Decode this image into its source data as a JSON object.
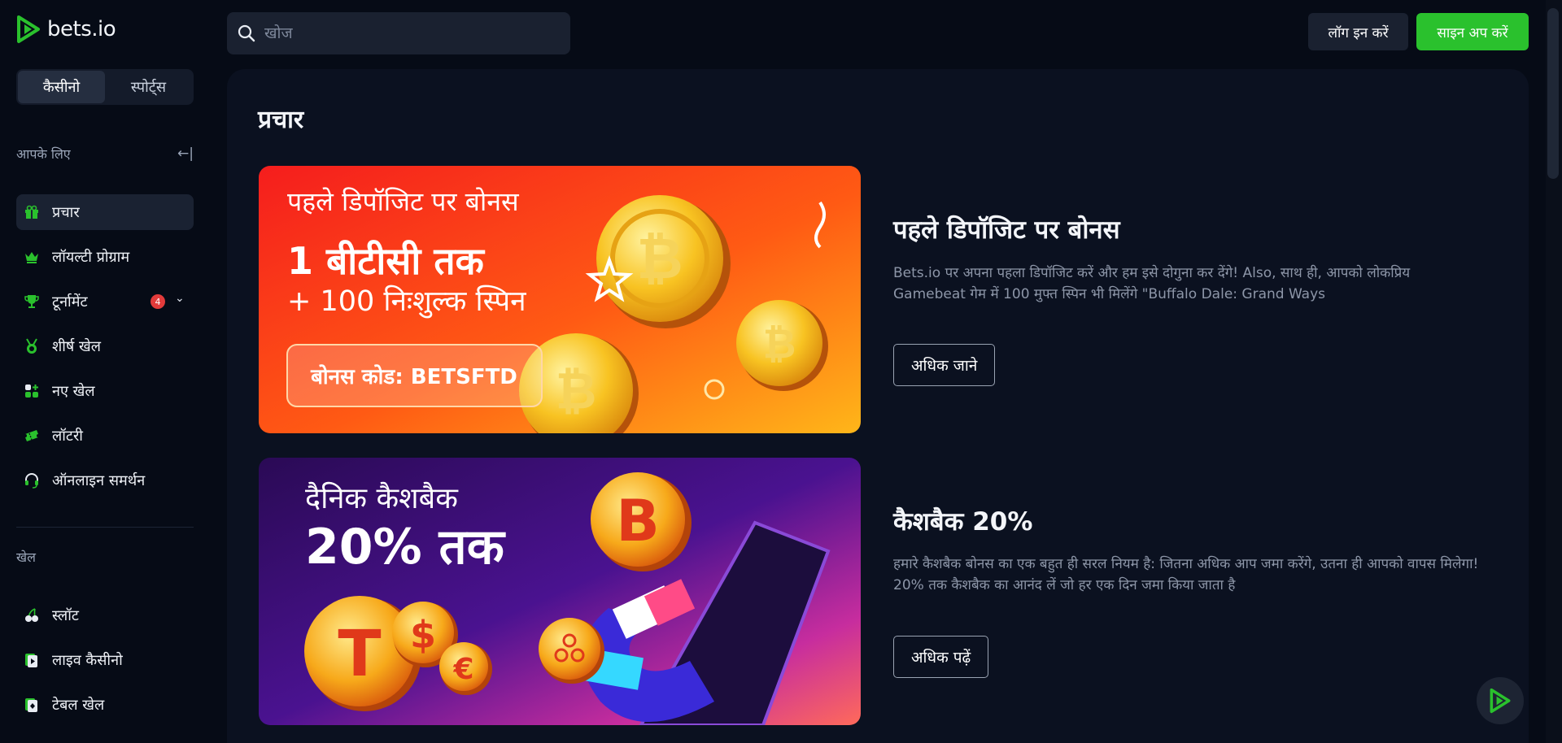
{
  "brand": {
    "name": "bets.io",
    "accent": "#2ac12d"
  },
  "mode_switch": {
    "casino": "कैसीनो",
    "sports": "स्पोर्ट्स"
  },
  "for_you": {
    "label": "आपके लिए",
    "collapse_icon": "collapse-left-icon"
  },
  "nav": [
    {
      "label": "प्रचार",
      "icon": "gift-icon",
      "active": true
    },
    {
      "label": "लॉयल्टी प्रोग्राम",
      "icon": "crown-icon"
    },
    {
      "label": "टूर्नामेंट",
      "icon": "trophy-icon",
      "badge": "4"
    },
    {
      "label": "शीर्ष खेल",
      "icon": "medal-icon"
    },
    {
      "label": "नए खेल",
      "icon": "new-games-icon"
    },
    {
      "label": "लॉटरी",
      "icon": "ticket-icon"
    },
    {
      "label": "ऑनलाइन समर्थन",
      "icon": "headset-icon"
    }
  ],
  "games_section": {
    "label": "खेल"
  },
  "games_nav": [
    {
      "label": "स्लॉट",
      "icon": "cherry-icon"
    },
    {
      "label": "लाइव कैसीनो",
      "icon": "live-casino-icon"
    },
    {
      "label": "टेबल खेल",
      "icon": "table-games-icon"
    }
  ],
  "search": {
    "placeholder": "खोज"
  },
  "header": {
    "login": "लॉग इन करें",
    "signup": "साइन अप करें"
  },
  "page": {
    "title": "प्रचार"
  },
  "promos": [
    {
      "banner": {
        "line1": "पहले डिपॉजिट पर बोनस",
        "line2": "1 बीटीसी तक",
        "line3": "+ 100 निःशुल्क स्पिन",
        "code": "बोनस कोड: BETSFTD"
      },
      "title": "पहले डिपॉजिट पर बोनस",
      "description": "Bets.io पर अपना पहला डिपॉजिट करें और हम इसे दोगुना कर देंगे! Also, साथ ही, आपको लोकप्रिय Gamebeat गेम में 100 मुफ्त स्पिन भी मिलेंगे \"Buffalo Dale: Grand Ways",
      "button": "अधिक जाने"
    },
    {
      "banner": {
        "line1": "दैनिक कैशबैक",
        "line2": "20% तक"
      },
      "title": "कैशबैक 20%",
      "description": "हमारे कैशबैक बोनस का एक बहुत ही सरल नियम है: जितना अधिक आप जमा करेंगे, उतना ही आपको वापस मिलेगा! 20% तक कैशबैक का आनंद लें जो हर एक दिन जमा किया जाता है",
      "button": "अधिक पढ़ें"
    }
  ]
}
